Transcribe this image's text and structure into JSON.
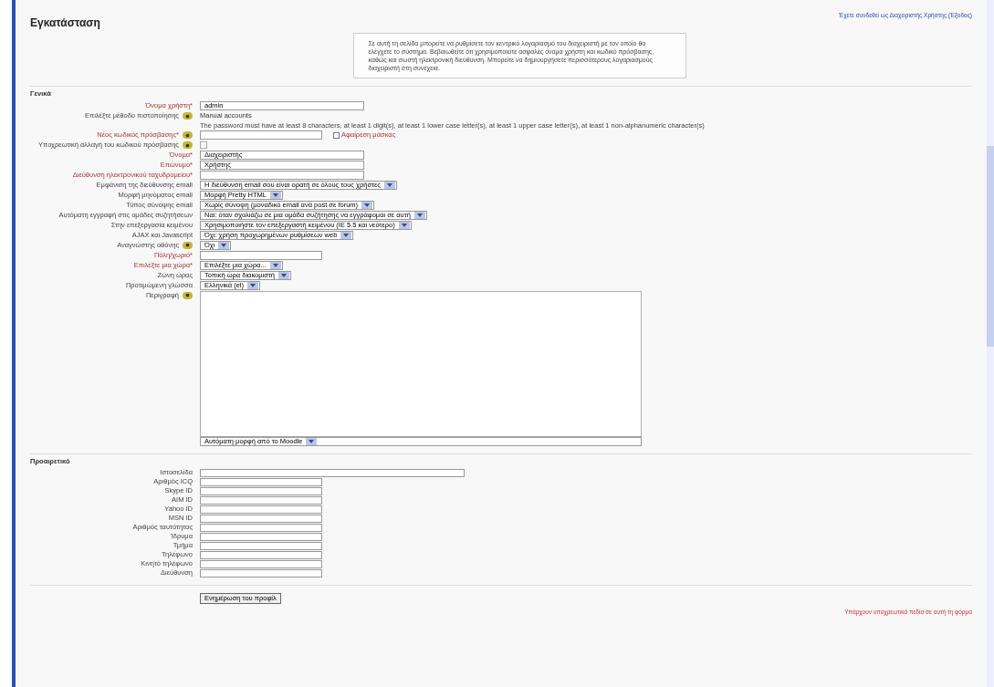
{
  "page": {
    "title": "Εγκατάσταση",
    "login_info": "Έχετε συνδεθεί ως Διαχειριστής Χρήστης (Έξοδος)"
  },
  "intro": "Σε αυτή τη σελίδα μπορείτε να ρυθμίσετε τον κεντρικό λογαριασμό του διαχειριστή με τον οποίο θα ελέγχετε το σύστημα. Βεβαιωθείτε ότι χρησιμοποιείτε ασφαλές όνομα χρήστη και κωδικό πρόσβασης, καθώς και σωστή ηλεκτρονική διεύθυνση. Μπορείτε να δημιουργήσετε περισσότερους λογαριασμούς διαχειριστή στη συνέχεια.",
  "sections": [
    {
      "title": "Γενικά",
      "fields": [
        {
          "kind": "text",
          "label": "Όνομα χρήστη*",
          "required": true,
          "help": false,
          "value": "admin"
        },
        {
          "kind": "static",
          "label": "Επιλέξτε μέθοδο πιστοποίησης",
          "required": false,
          "help": true,
          "value": "Manual accounts"
        },
        {
          "kind": "note",
          "value": "The password must have at least 8 characters, at least 1 digit(s), at least 1 lower case letter(s), at least 1 upper case letter(s), at least 1 non-alphanumeric character(s)"
        },
        {
          "kind": "password",
          "label": "Νέος κωδικός πρόσβασης*",
          "required": true,
          "help": true,
          "unmask_label": "Αφαίρεση μάσκας",
          "unmask_checked": false
        },
        {
          "kind": "checkbox",
          "label": "Υποχρεωτική αλλαγή του κωδικού πρόσβασης",
          "required": false,
          "help": true,
          "checked": false
        },
        {
          "kind": "text",
          "label": "Όνομα*",
          "required": true,
          "help": false,
          "value": "Διαχειριστής"
        },
        {
          "kind": "text",
          "label": "Επώνυμο*",
          "required": true,
          "help": false,
          "value": "Χρήστης"
        },
        {
          "kind": "text",
          "label": "Διεύθυνση ηλεκτρονικού ταχυδρομείου*",
          "required": true,
          "help": false
        },
        {
          "kind": "select",
          "label": "Εμφάνιση της διεύθυνσης email",
          "required": false,
          "help": false,
          "value": "Η διεύθυνση email σου είναι ορατή σε όλους τους χρήστες"
        },
        {
          "kind": "select",
          "label": "Μορφή μηνύματος email",
          "required": false,
          "help": false,
          "value": "Μορφή Pretty HTML"
        },
        {
          "kind": "select",
          "label": "Τύπος σύνοψης email",
          "required": false,
          "help": false,
          "value": "Χωρίς σύνοψη (μοναδικό email ανά post σε forum)"
        },
        {
          "kind": "select",
          "label": "Αυτόματη εγγραφή στις ομάδες συζητήσεων",
          "required": false,
          "help": false,
          "value": "Ναι: όταν σχολιάζω σε μια ομάδα συζήτησης να εγγράφομαι σε αυτή"
        },
        {
          "kind": "select",
          "label": "Στην επεξεργασία κειμένου",
          "required": false,
          "help": false,
          "value": "Χρησιμοποιήστε τον επεξεργαστή κειμένου (IE 5.5 και νεότερο)"
        },
        {
          "kind": "select",
          "label": "AJAX και Javascript",
          "required": false,
          "help": false,
          "value": "Όχι: χρήση προχωρημένων ρυθμίσεων web"
        },
        {
          "kind": "select",
          "label": "Αναγνώστης οθόνης",
          "required": false,
          "help": true,
          "value": "Όχι"
        },
        {
          "kind": "short_text",
          "label": "Πόλη/χωριό*",
          "required": true,
          "help": false
        },
        {
          "kind": "select",
          "label": "Επιλέξτε μια χώρα*",
          "required": true,
          "help": false,
          "value": "Επιλέξτε μια χώρα..."
        },
        {
          "kind": "select",
          "label": "Ζώνη ώρας",
          "required": false,
          "help": false,
          "value": "Τοπική ώρα διακομιστή"
        },
        {
          "kind": "select",
          "label": "Προτιμώμενη γλώσσα",
          "required": false,
          "help": false,
          "value": "Ελληνικά (el)"
        },
        {
          "kind": "textarea",
          "label": "Περιγραφή",
          "required": false,
          "help": true,
          "format": "Αυτόματη μορφή από το Moodle"
        }
      ]
    },
    {
      "title": "Προαιρετικό",
      "fields": [
        {
          "kind": "long_text",
          "label": "Ιστοσελίδα",
          "required": false,
          "help": false
        },
        {
          "kind": "short_text",
          "label": "Αριθμός ICQ",
          "required": false,
          "help": false
        },
        {
          "kind": "short_text",
          "label": "Skype ID",
          "required": false,
          "help": false
        },
        {
          "kind": "short_text",
          "label": "AIM ID",
          "required": false,
          "help": false
        },
        {
          "kind": "short_text",
          "label": "Yahoo ID",
          "required": false,
          "help": false
        },
        {
          "kind": "short_text",
          "label": "MSN ID",
          "required": false,
          "help": false
        },
        {
          "kind": "short_text",
          "label": "Αριθμός ταυτότητας",
          "required": false,
          "help": false
        },
        {
          "kind": "short_text",
          "label": "Ίδρυμα",
          "required": false,
          "help": false
        },
        {
          "kind": "short_text",
          "label": "Τμήμα",
          "required": false,
          "help": false
        },
        {
          "kind": "short_text",
          "label": "Τηλέφωνο",
          "required": false,
          "help": false
        },
        {
          "kind": "short_text",
          "label": "Κινητό τηλέφωνο",
          "required": false,
          "help": false
        },
        {
          "kind": "short_text",
          "label": "Διεύθυνση",
          "required": false,
          "help": false
        }
      ]
    }
  ],
  "submit": "Ενημέρωση του προφίλ",
  "required_note": "Υπάρχουν υποχρεωτικά πεδία σε αυτή τη φόρμα"
}
